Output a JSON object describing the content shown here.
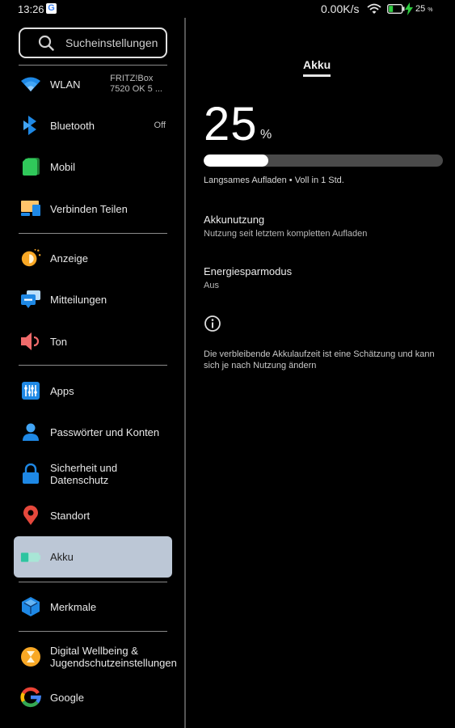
{
  "status_bar": {
    "time": "13:26",
    "notification_icon": "google-g-icon",
    "net_speed": "0.00K/s",
    "wifi_icon": "wifi-icon",
    "battery_icon": "battery-charging-icon",
    "battery_percent": "25",
    "battery_percent_unit": "%"
  },
  "sidebar": {
    "search_placeholder": "Sucheinstellungen",
    "items": [
      {
        "label": "WLAN",
        "value": "FRITZ!Box\n7520 OK 5 ...",
        "icon": "wifi-icon"
      },
      {
        "label": "Bluetooth",
        "value": "Off",
        "icon": "bluetooth-icon"
      },
      {
        "label": "Mobil",
        "icon": "sim-card-icon"
      },
      {
        "label": "Verbinden Teilen",
        "icon": "connect-share-icon"
      },
      {
        "label": "Anzeige",
        "icon": "display-brightness-icon"
      },
      {
        "label": "Mitteilungen",
        "icon": "notifications-icon"
      },
      {
        "label": "Ton",
        "icon": "sound-icon"
      },
      {
        "label": "Apps",
        "icon": "apps-sliders-icon"
      },
      {
        "label": "Passwörter und Konten",
        "icon": "account-icon"
      },
      {
        "label": "Sicherheit und Datenschutz",
        "icon": "lock-icon"
      },
      {
        "label": "Standort",
        "icon": "location-pin-icon"
      },
      {
        "label": "Akku",
        "icon": "battery-icon",
        "selected": true
      },
      {
        "label": "Merkmale",
        "icon": "features-cube-icon"
      },
      {
        "label": "Digital Wellbeing & Jugendschutzeinstellungen",
        "icon": "hourglass-icon"
      },
      {
        "label": "Google",
        "icon": "google-icon"
      }
    ]
  },
  "detail": {
    "title": "Akku",
    "battery_level": "25",
    "battery_level_unit": "%",
    "battery_fraction": 0.25,
    "charge_status": "Langsames Aufladen • Voll in 1 Std.",
    "prefs": [
      {
        "title": "Akkunutzung",
        "subtitle": "Nutzung seit letztem kompletten Aufladen"
      },
      {
        "title": "Energiesparmodus",
        "subtitle": "Aus"
      }
    ],
    "info_text": "Die verbleibende Akkulaufzeit ist eine Schätzung und kann sich je nach Nutzung ändern"
  },
  "colors": {
    "selected_item_bg": "#bcc7d6",
    "progress_fill": "#ffffff",
    "progress_track": "#4a4a4a",
    "charging_green": "#2ecc40"
  }
}
